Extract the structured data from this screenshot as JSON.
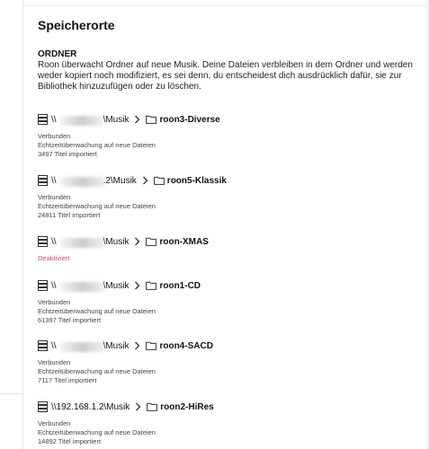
{
  "page": {
    "title": "Speicherorte"
  },
  "section": {
    "heading": "ORDNER",
    "description": "Roon überwacht Ordner auf neue Musik. Deine Dateien verbleiben in dem Ordner und werden weder kopiert noch modifiziert, es sei denn, du entscheidest dich ausdrücklich dafür, sie zur Bibliothek hinzuzufügen oder zu löschen."
  },
  "locations": [
    {
      "share_prefix": "\\\\",
      "share_suffix": "\\Musik",
      "folder": "roon3-Diverse",
      "status": "Verbunden",
      "watch": "Echtzeitüberwachung auf neue Dateien",
      "imported": "3497 Titel importiert"
    },
    {
      "share_prefix": "\\\\",
      "share_suffix": ".2\\Musik",
      "folder": "roon5-Klassik",
      "status": "Verbunden",
      "watch": "Echtzeitüberwachung auf neue Dateien",
      "imported": "24811 Titel importiert"
    },
    {
      "share_prefix": "\\\\",
      "share_suffix": "\\Musik",
      "folder": "roon-XMAS",
      "status": "Deaktiviert"
    },
    {
      "share_prefix": "\\\\",
      "share_suffix": "\\Musik",
      "folder": "roon1-CD",
      "status": "Verbunden",
      "watch": "Echtzeitüberwachung auf neue Dateien",
      "imported": "61397 Titel importiert"
    },
    {
      "share_prefix": "\\\\",
      "share_suffix": "\\Musik",
      "folder": "roon4-SACD",
      "status": "Verbunden",
      "watch": "Echtzeitüberwachung auf neue Dateien",
      "imported": "7117 Titel importiert"
    },
    {
      "share_prefix": "\\\\192.168.1.2\\Musik",
      "share_suffix": "",
      "folder": "roon2-HiRes",
      "status": "Verbunden",
      "watch": "Echtzeitüberwachung auf neue Dateien",
      "imported": "14892 Titel importiert"
    }
  ],
  "colors": {
    "deactivated": "#d9445b",
    "text": "#222222"
  },
  "icons": {
    "storage": "database-icon",
    "separator": "chevron-right-icon",
    "folder": "folder-icon"
  }
}
